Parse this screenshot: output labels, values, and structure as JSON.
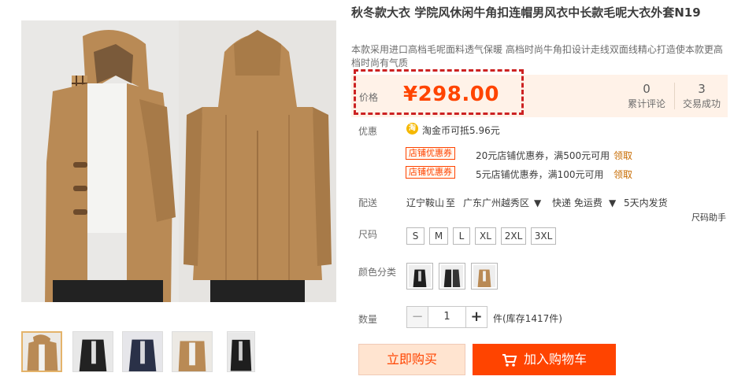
{
  "product": {
    "title": "秋冬款大衣 学院风休闲牛角扣连帽男风衣中长款毛呢大衣外套N19",
    "subtitle": "本款采用进口高档毛呢面料透气保暖 高档时尚牛角扣设计走线双面线精心打造使本款更高档时尚有气质"
  },
  "price": {
    "label": "价格",
    "value": "¥298.00",
    "reviews_count": "0",
    "reviews_label": "累计评论",
    "sales_count": "3",
    "sales_label": "交易成功"
  },
  "promo": {
    "label": "优惠",
    "coin_icon": "coin-icon",
    "coin_text": "淘金币可抵5.96元",
    "coupons": [
      {
        "tag": "店铺优惠券",
        "text": "20元店铺优惠券，满500元可用",
        "link": "领取"
      },
      {
        "tag": "店铺优惠券",
        "text": "5元店铺优惠券，满100元可用",
        "link": "领取"
      }
    ]
  },
  "shipping": {
    "label": "配送",
    "from": "辽宁鞍山",
    "to_word": "至",
    "to": "广东广州越秀区",
    "method": "快递 免运费",
    "delivery": "5天内发货",
    "size_helper": "尺码助手"
  },
  "sizes": {
    "label": "尺码",
    "options": [
      "S",
      "M",
      "L",
      "XL",
      "2XL",
      "3XL"
    ]
  },
  "colors": {
    "label": "颜色分类"
  },
  "quantity": {
    "label": "数量",
    "value": "1",
    "minus": "−",
    "plus": "+",
    "stock": "件(库存1417件)"
  },
  "actions": {
    "buy_now": "立即购买",
    "add_to_cart": "加入购物车"
  },
  "theme": {
    "accent": "#ff4400",
    "price_bg": "#fff2e8",
    "highlight_border": "#cc2222",
    "coat_camel": "#b98a55",
    "coat_black": "#222222",
    "coat_navy": "#2a3148"
  }
}
